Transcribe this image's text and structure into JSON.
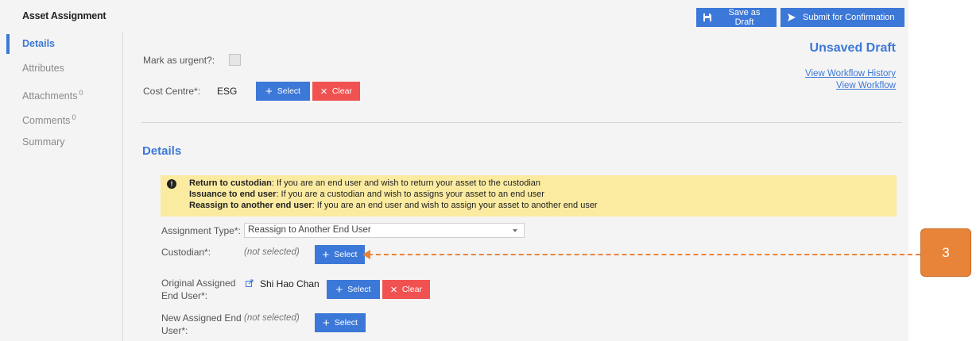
{
  "app": {
    "title": "Asset Assignment",
    "save_draft_label": "Save as Draft",
    "submit_label": "Submit for Confirmation"
  },
  "sidebar": {
    "items": [
      {
        "label": "Details",
        "sup": "",
        "active": true
      },
      {
        "label": "Attributes",
        "sup": ""
      },
      {
        "label": "Attachments",
        "sup": "0"
      },
      {
        "label": "Comments",
        "sup": "0"
      },
      {
        "label": "Summary",
        "sup": ""
      }
    ]
  },
  "header": {
    "urgent_label": "Mark as urgent?:",
    "cost_centre_label": "Cost Centre*:",
    "cost_centre_value": "ESG",
    "select_label": "Select",
    "clear_label": "Clear",
    "status": "Unsaved Draft",
    "workflow_history_link": "View Workflow History",
    "workflow_link": "View Workflow"
  },
  "details": {
    "section_title": "Details",
    "info": {
      "line1_bold": "Return to custodian",
      "line1_text": ": If you are an end user and wish to return your asset to the custodian",
      "line2_bold": "Issuance to end user",
      "line2_text": ": If you are a custodian and wish to assigns your asset to an end user",
      "line3_bold": "Reassign to another end user",
      "line3_text": ": If you are an end user and wish to assign your asset to another end user"
    },
    "assignment_type_label": "Assignment Type*:",
    "assignment_type_value": "Reassign to Another End User",
    "custodian_label": "Custodian*:",
    "custodian_value": "(not selected)",
    "original_user_label_1": "Original Assigned",
    "original_user_label_2": "End User*:",
    "original_user_value": "Shi Hao Chan",
    "new_user_label_1": "New Assigned End",
    "new_user_label_2": "User*:",
    "new_user_value": "(not selected)",
    "select_label": "Select",
    "clear_label": "Clear"
  },
  "callout": {
    "number": "3",
    "color": "#e8843a"
  },
  "colors": {
    "accent": "#3c78d8",
    "danger": "#f05252",
    "info_bg": "#fbeba1"
  }
}
